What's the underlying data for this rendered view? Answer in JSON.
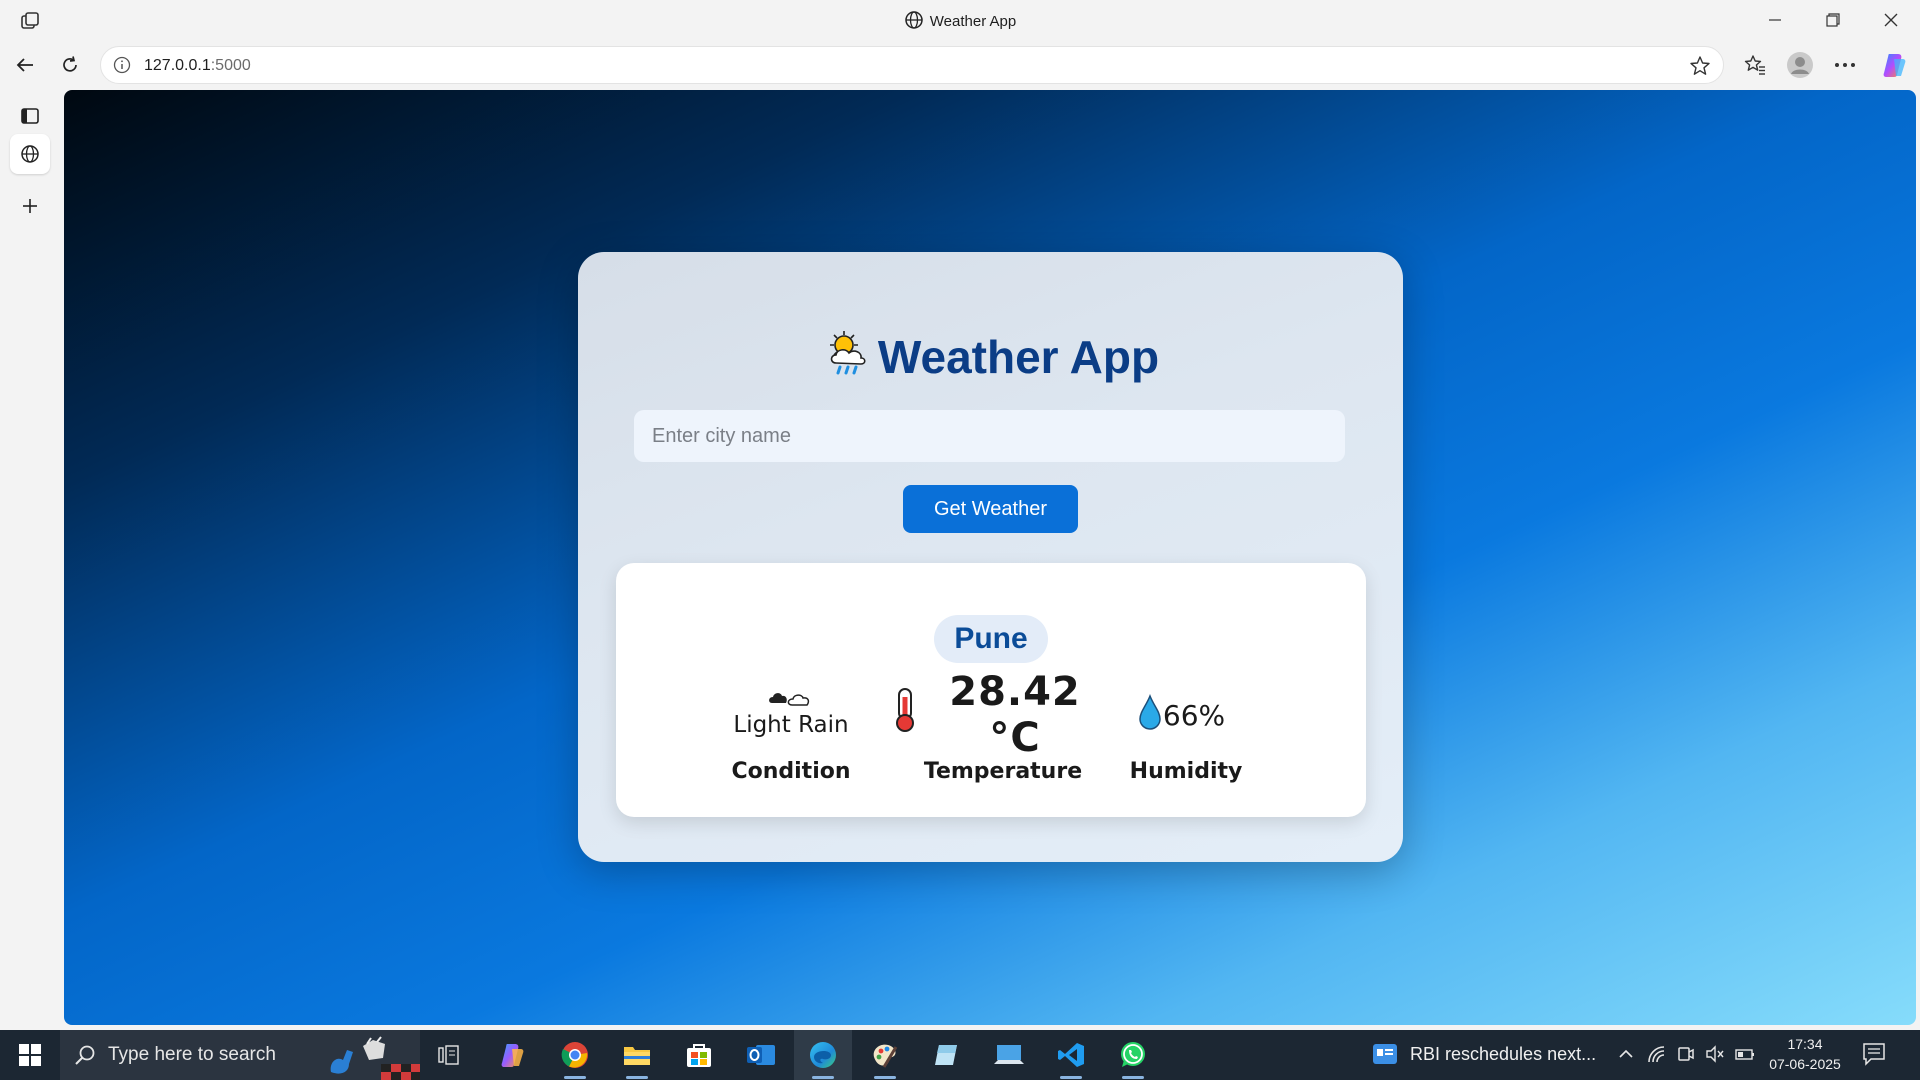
{
  "browser": {
    "window_title": "Weather App",
    "url_host": "127.0.0.1",
    "url_port": ":5000"
  },
  "page": {
    "app_title": "Weather App",
    "search": {
      "placeholder": "Enter city name",
      "value": ""
    },
    "button_label": "Get Weather",
    "result": {
      "city": "Pune",
      "condition": "Light Rain",
      "temperature": "28.42 °C",
      "humidity": "66%",
      "labels": {
        "condition": "Condition",
        "temperature": "Temperature",
        "humidity": "Humidity"
      }
    }
  },
  "taskbar": {
    "search_placeholder": "Type here to search",
    "news": "RBI reschedules next...",
    "time": "17:34",
    "date": "07-06-2025"
  },
  "colors": {
    "accent": "#0a70d8",
    "title": "#0b3d86",
    "city": "#0b4c98",
    "taskbar": "#1c2733"
  },
  "icons": [
    "workspaces-icon",
    "globe-icon",
    "back-icon",
    "refresh-icon",
    "info-icon",
    "star-icon",
    "favorites-icon",
    "profile-icon",
    "more-icon",
    "copilot-icon",
    "tabs-icon",
    "new-tab-icon",
    "windows-start-icon",
    "search-icon",
    "task-view-icon",
    "thermometer-icon",
    "droplet-icon",
    "cloud-icon",
    "cloud-rain-sun-emoji"
  ]
}
